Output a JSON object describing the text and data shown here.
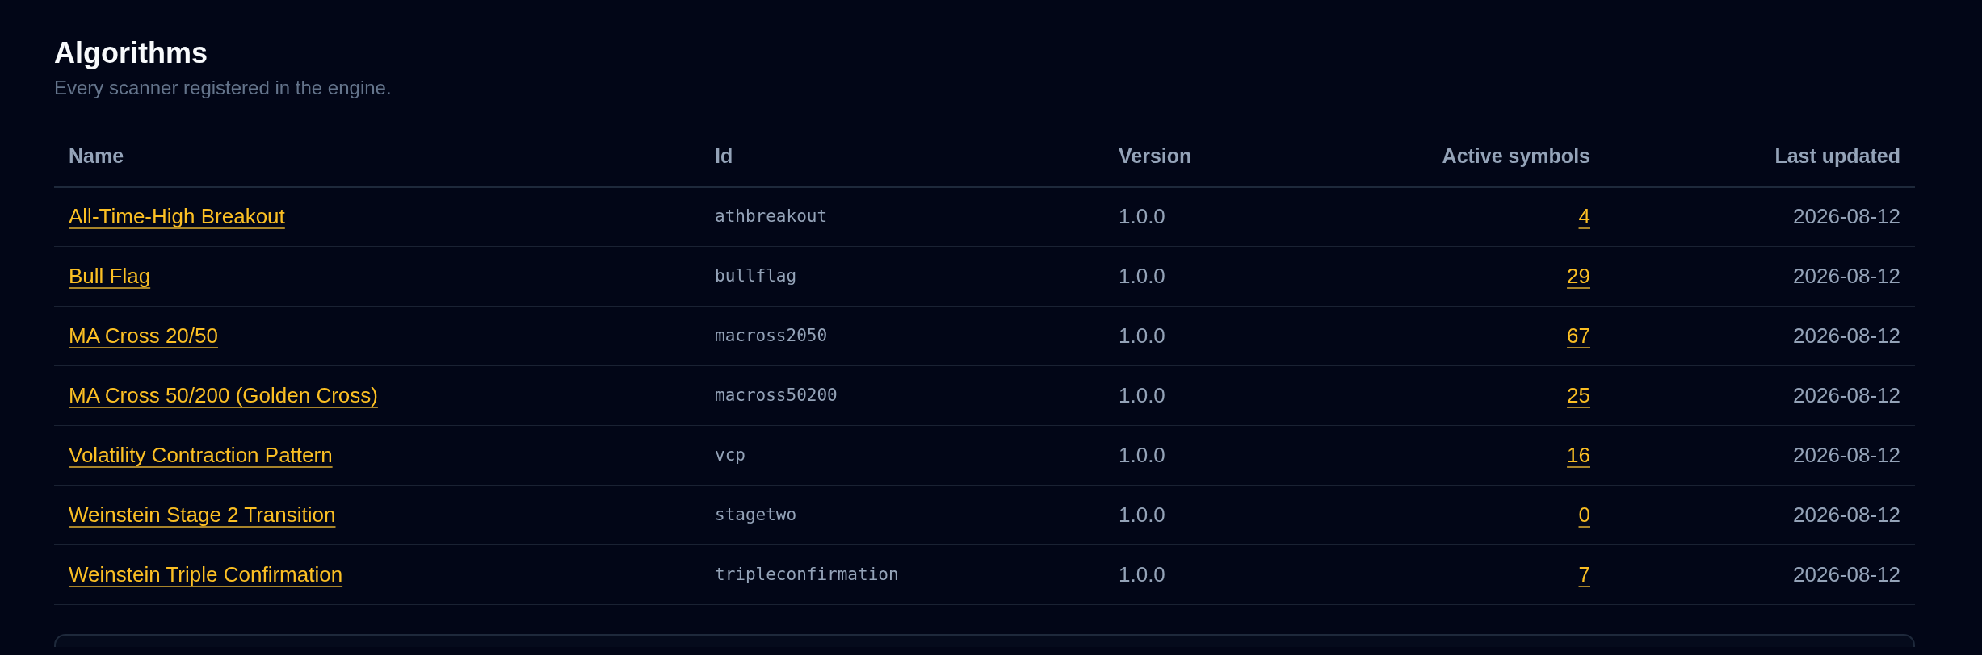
{
  "header": {
    "title": "Algorithms",
    "subtitle": "Every scanner registered in the engine."
  },
  "table": {
    "columns": [
      "Name",
      "Id",
      "Version",
      "Active symbols",
      "Last updated"
    ],
    "rows": [
      {
        "name": "All-Time-High Breakout",
        "id": "athbreakout",
        "version": "1.0.0",
        "active_symbols": "4",
        "last_updated": "2026-08-12"
      },
      {
        "name": "Bull Flag",
        "id": "bullflag",
        "version": "1.0.0",
        "active_symbols": "29",
        "last_updated": "2026-08-12"
      },
      {
        "name": "MA Cross 20/50",
        "id": "macross2050",
        "version": "1.0.0",
        "active_symbols": "67",
        "last_updated": "2026-08-12"
      },
      {
        "name": "MA Cross 50/200 (Golden Cross)",
        "id": "macross50200",
        "version": "1.0.0",
        "active_symbols": "25",
        "last_updated": "2026-08-12"
      },
      {
        "name": "Volatility Contraction Pattern",
        "id": "vcp",
        "version": "1.0.0",
        "active_symbols": "16",
        "last_updated": "2026-08-12"
      },
      {
        "name": "Weinstein Stage 2 Transition",
        "id": "stagetwo",
        "version": "1.0.0",
        "active_symbols": "0",
        "last_updated": "2026-08-12"
      },
      {
        "name": "Weinstein Triple Confirmation",
        "id": "tripleconfirmation",
        "version": "1.0.0",
        "active_symbols": "7",
        "last_updated": "2026-08-12"
      }
    ]
  }
}
